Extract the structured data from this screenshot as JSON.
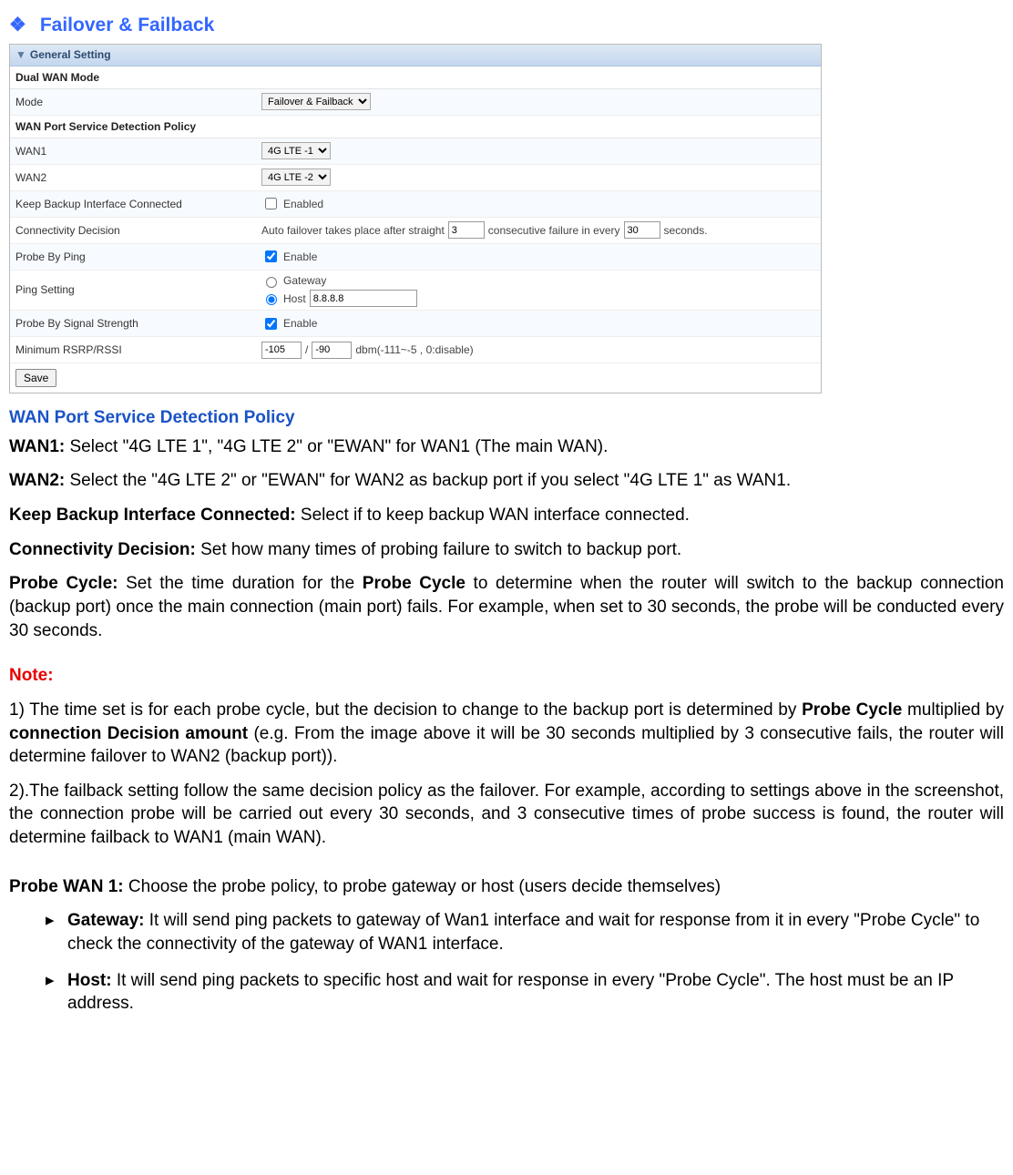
{
  "heading": "Failover & Failback",
  "ss": {
    "general_setting": "General Setting",
    "dual_wan_mode": "Dual WAN Mode",
    "mode_label": "Mode",
    "mode_value": "Failover & Failback",
    "policy_title": "WAN Port Service Detection Policy",
    "wan1_label": "WAN1",
    "wan1_value": "4G LTE -1",
    "wan2_label": "WAN2",
    "wan2_value": "4G LTE -2",
    "keep_backup_label": "Keep Backup Interface Connected",
    "enabled_text": "Enabled",
    "conn_dec_label": "Connectivity Decision",
    "conn_dec_pre": "Auto failover takes place after straight",
    "conn_dec_mid": "consecutive failure in every",
    "conn_dec_post": "seconds.",
    "conn_dec_n": "3",
    "conn_dec_s": "30",
    "probe_ping_label": "Probe By Ping",
    "enable_text": "Enable",
    "ping_setting_label": "Ping Setting",
    "gateway_text": "Gateway",
    "host_text": "Host",
    "host_value": "8.8.8.8",
    "probe_signal_label": "Probe By Signal Strength",
    "min_rsrp_label": "Minimum RSRP/RSSI",
    "rsrp_a": "-105",
    "rsrp_b": "-90",
    "rsrp_unit": "dbm(-111~-5 , 0:disable)",
    "save": "Save"
  },
  "policy_heading": "WAN Port Service Detection Policy",
  "wan1": {
    "lead": "WAN1:",
    "body": " Select \"4G LTE 1\", \"4G LTE 2\" or \"EWAN\" for WAN1 (The main WAN)."
  },
  "wan2": {
    "lead": "WAN2:",
    "body": " Select the \"4G LTE 2\" or \"EWAN\" for WAN2 as backup port if you select \"4G LTE 1\" as WAN1."
  },
  "kbic": {
    "lead": "Keep Backup Interface Connected:",
    "body": " Select if to keep backup WAN interface connected."
  },
  "cd": {
    "lead": "Connectivity Decision:",
    "body": " Set how many times of probing failure to switch to backup port."
  },
  "pc": {
    "lead": "Probe Cycle:",
    "body_pre": " Set the time duration for the ",
    "body_mid_bold": "Probe Cycle",
    "body_post": " to determine when the router will switch to the backup connection (backup port) once the main connection (main port) fails. For example, when set to 30 seconds, the probe will be conducted every 30 seconds."
  },
  "note_label": "Note:",
  "note1_pre": "1) The time set is for each probe cycle, but the decision to change to the backup port is determined by ",
  "note1_b1": "Probe Cycle",
  "note1_mid": " multiplied by ",
  "note1_b2": "connection Decision amount",
  "note1_post": " (e.g. From the image above it will be 30 seconds multiplied by 3 consecutive fails, the router will determine failover to WAN2 (backup port)).",
  "note2": "2).The failback setting follow the same decision policy as the failover. For example, according to settings above in the screenshot, the connection probe will be carried out every 30 seconds, and 3 consecutive times of probe success is found, the router will determine failback to WAN1 (main WAN).",
  "pw1": {
    "lead": "Probe WAN 1:",
    "body": " Choose the probe policy, to probe gateway or host (users decide themselves)"
  },
  "gw_item": {
    "lead": "Gateway:",
    "body": " It will send ping packets to gateway of Wan1 interface and wait for response from it in every \"Probe Cycle\" to check the connectivity of the gateway of WAN1 interface."
  },
  "host_item": {
    "lead": "Host:",
    "body": " It will send ping packets to specific host and wait for response in every \"Probe Cycle\". The host must be an IP address."
  }
}
